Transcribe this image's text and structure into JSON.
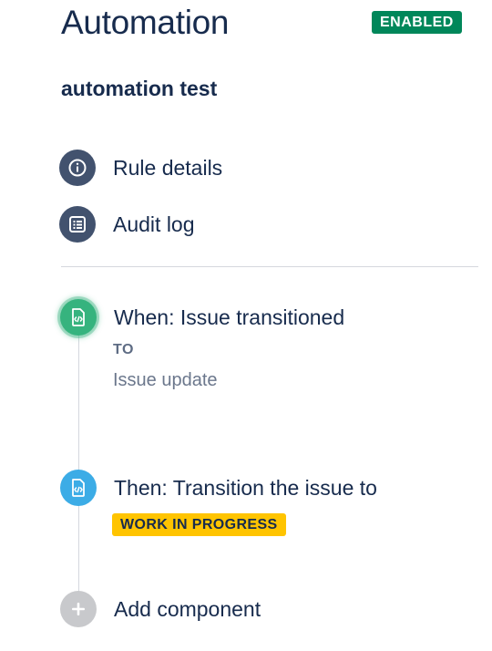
{
  "header": {
    "title": "Automation",
    "status_badge": "ENABLED"
  },
  "rule": {
    "name": "automation test"
  },
  "nav": {
    "items": [
      {
        "label": "Rule details",
        "icon": "info-icon"
      },
      {
        "label": "Audit log",
        "icon": "list-icon"
      }
    ]
  },
  "steps": {
    "trigger": {
      "title": "When: Issue transitioned",
      "qualifier": "TO",
      "detail": "Issue update",
      "icon": "file-code-icon",
      "color": "#36b37e"
    },
    "action": {
      "title": "Then: Transition the issue to",
      "status": "WORK IN PROGRESS",
      "icon": "file-code-icon",
      "color": "#3cace6",
      "status_color": "#ffc400"
    },
    "add": {
      "label": "Add component",
      "icon": "plus-icon"
    }
  },
  "colors": {
    "enabled": "#00875a",
    "nav_icon": "#42526e",
    "text": "#172b4d"
  }
}
